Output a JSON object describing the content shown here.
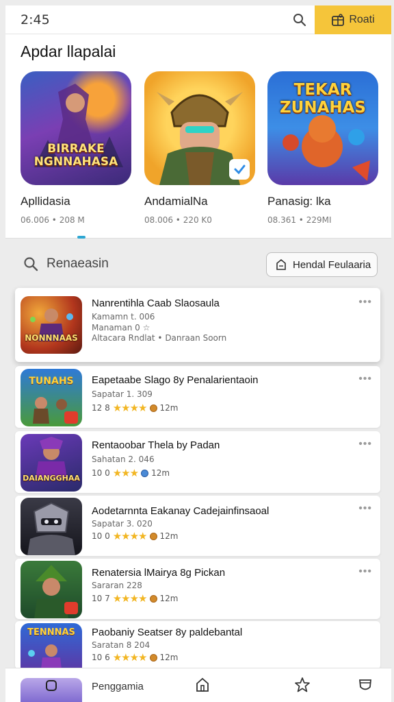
{
  "status": {
    "time": "2:45"
  },
  "header": {
    "rewards_label": "Roati",
    "search_icon": "search-icon",
    "rewards_icon": "gift-icon"
  },
  "featured": {
    "title": "Apdar llapalai",
    "apps": [
      {
        "name": "Apllidasia",
        "meta": "06.006 • 208 M",
        "art_text": "BIRRAKE NGNNAHASA"
      },
      {
        "name": "AndamialNa",
        "meta": "08.006 • 220 K0",
        "art_text": ""
      },
      {
        "name": "Panasig: lka",
        "meta": "08.361 • 229MI",
        "art_text": "TEKAR ZUNAHAS"
      }
    ]
  },
  "search": {
    "label": "Renaeasin",
    "filter_label": "Hendal Feulaaria"
  },
  "list": [
    {
      "title": "Nanrentihla Caab Slaosaula",
      "sub1": "Kamamn t. 006",
      "sub2": "Manaman 0 ☆",
      "sub3": "Altacara Rndlat • Danraan Soorn",
      "art_text": "NONNNAAS"
    },
    {
      "title": "Eapetaabe Slago 8y Penalarientaoin",
      "sub1": "Sapatar 1. 309",
      "rating": "12 8",
      "size": "12m",
      "art_text": "TUNAHS"
    },
    {
      "title": "Rentaoobar Thela by Padan",
      "sub1": "Sahatan 2. 046",
      "rating": "10 0",
      "size": "12m",
      "art_text": "DAIANGGHAA"
    },
    {
      "title": "Aodetarnnta Eakanay Cadejainfinsaoal",
      "sub1": "Sapatar 3. 020",
      "rating": "10 0",
      "size": "12m",
      "art_text": ""
    },
    {
      "title": "Renatersia lMairya 8g Pickan",
      "sub1": "Sararan 228",
      "rating": "10 7",
      "size": "12m",
      "art_text": ""
    },
    {
      "title": "Paobaniy Seatser 8y paldebantal",
      "sub1": "Saratan 8 204",
      "rating": "10 6",
      "size": "12m",
      "art_text": "TENNNAS"
    }
  ],
  "bottom_nav": {
    "label": "Penggamia"
  },
  "colors": {
    "accent": "#f5c53a",
    "star": "#f2b623",
    "indicator": "#2ea7d3"
  }
}
